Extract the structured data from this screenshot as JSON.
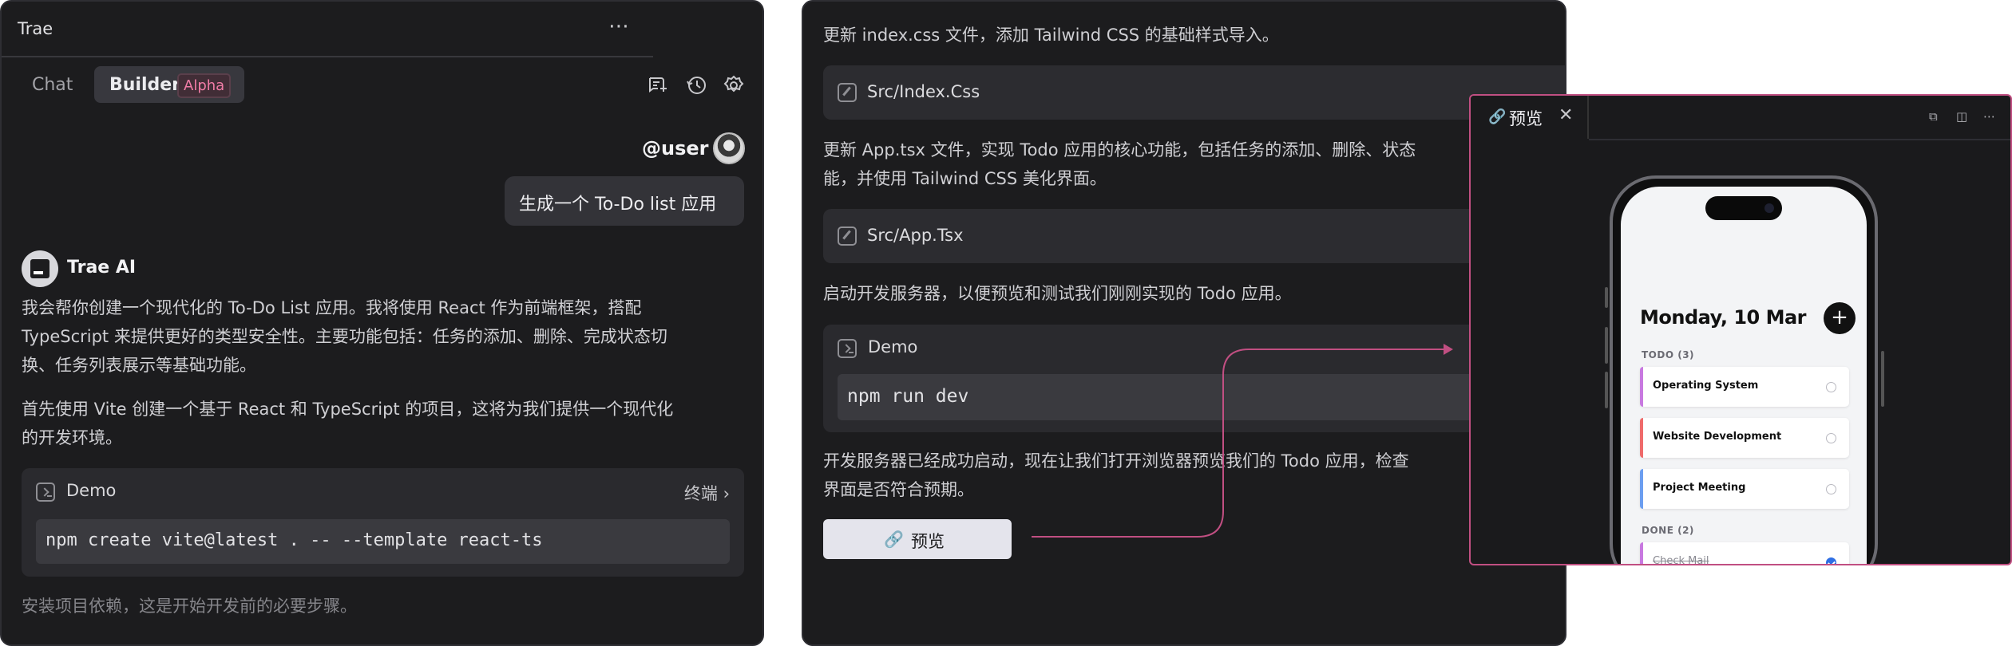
{
  "left": {
    "title": "Trae",
    "more_icon": "⋯",
    "tabs": {
      "chat": "Chat",
      "builder": "Builder",
      "builder_badge": "Alpha"
    },
    "toolbar_icons": [
      "new-chat-icon",
      "history-icon",
      "settings-icon"
    ],
    "user": {
      "handle": "@user",
      "message": "生成一个 To-Do list 应用"
    },
    "ai": {
      "name": "Trae AI",
      "para1": [
        "我会帮你创建一个现代化的 To-Do List 应用。我将使用 React 作为前端框架，搭配",
        "TypeScript 来提供更好的类型安全性。主要功能包括：任务的添加、删除、完成状态切",
        "换、任务列表展示等基础功能。"
      ],
      "para2": [
        "首先使用 Vite 创建一个基于 React 和 TypeScript 的项目，这将为我们提供一个现代化",
        "的开发环境。"
      ],
      "command": {
        "name": "Demo",
        "terminal_link": "终端",
        "code": "npm create vite@latest . -- --template react-ts"
      },
      "para3": "安装项目依赖，这是开始开发前的必要步骤。"
    }
  },
  "mid": {
    "line1": "更新 index.css 文件，添加 Tailwind CSS 的基础样式导入。",
    "file1": "Src/Index.Css",
    "line2a": "更新 App.tsx 文件，实现 Todo 应用的核心功能，包括任务的添加、删除、状态",
    "line2b": "能，并使用 Tailwind CSS 美化界面。",
    "file2": "Src/App.Tsx",
    "line3": "启动开发服务器，以便预览和测试我们刚刚实现的 Todo 应用。",
    "demo": {
      "name": "Demo",
      "code": "npm run dev"
    },
    "line4a": "开发服务器已经成功启动，现在让我们打开浏览器预览我们的 Todo 应用，检查",
    "line4b": "界面是否符合预期。",
    "preview_button": "预览"
  },
  "preview": {
    "tab_label": "预览",
    "close": "✕",
    "controls": [
      "⧉",
      "◫",
      "⋯"
    ],
    "app": {
      "date": "Monday, 10 Mar",
      "add": "+",
      "todo_header": "TODO (3)",
      "done_header": "DONE (2)",
      "todos": [
        {
          "title": "Operating System",
          "color": "#c879e0",
          "done": false
        },
        {
          "title": "Website Development",
          "color": "#ef6b6b",
          "done": false
        },
        {
          "title": "Project Meeting",
          "color": "#6c9ef0",
          "done": false
        }
      ],
      "done": [
        {
          "title": "Check Mail",
          "color": "#c879e0",
          "done": true
        }
      ]
    }
  },
  "colors": {
    "accent_pink": "#c14f82",
    "badge_pink": "#f07ca6",
    "panel_bg": "#1c1c1e"
  }
}
